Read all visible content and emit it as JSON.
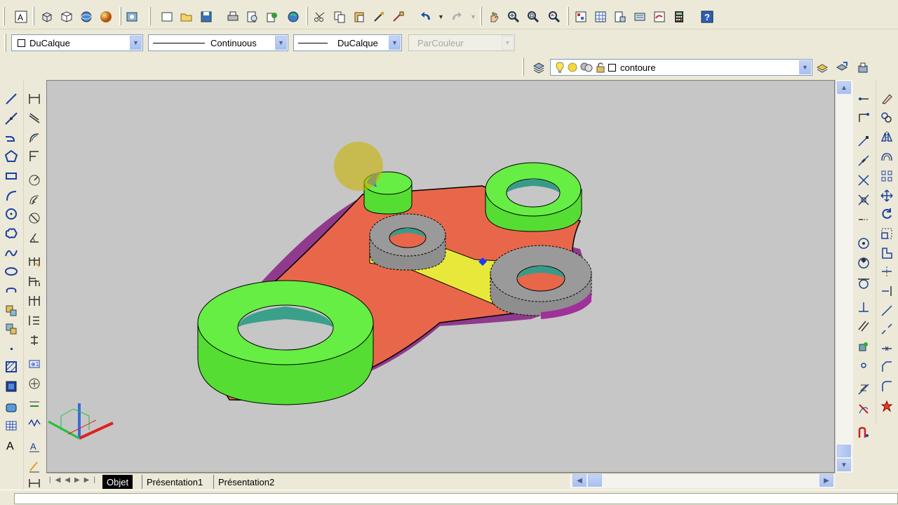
{
  "toolbar_top": {
    "icons": [
      "new-text-icon",
      "box-icon",
      "wedge-icon",
      "sphere-icon",
      "shade-sphere-icon",
      "render-icon",
      "new-file-icon",
      "open-file-icon",
      "save-icon",
      "print-icon",
      "plot-preview-icon",
      "publish-icon",
      "web-icon",
      "cut-icon",
      "copy-icon",
      "paste-icon",
      "match-properties-icon",
      "block-editor-icon",
      "undo-icon",
      "redo-icon",
      "pan-icon",
      "zoom-realtime-icon",
      "zoom-window-icon",
      "zoom-previous-icon",
      "properties-icon",
      "design-center-icon",
      "tool-palettes-icon",
      "sheet-set-icon",
      "markup-icon",
      "quickcalc-icon",
      "help-icon"
    ]
  },
  "properties_bar": {
    "color_value": "DuCalque",
    "linetype_value": "Continuous",
    "lineweight_value": "DuCalque",
    "plotstyle_value": "ParCouleur"
  },
  "layers_bar": {
    "layer_name": "contoure",
    "icons": [
      "layer-manager-icon",
      "bulb-icon",
      "sun-icon",
      "lock-icon",
      "color-swatch-icon",
      "make-current-icon",
      "layer-previous-icon",
      "layer-states-icon"
    ]
  },
  "left_toolbar_draw": [
    "line-icon",
    "construction-line-icon",
    "polyline-icon",
    "polygon-icon",
    "rectangle-icon",
    "arc-icon",
    "circle-icon",
    "revision-cloud-icon",
    "spline-icon",
    "ellipse-icon",
    "ellipse-arc-icon",
    "insert-block-icon",
    "make-block-icon",
    "point-icon",
    "hatch-icon",
    "gradient-icon",
    "region-icon",
    "table-icon",
    "mtext-icon"
  ],
  "left_toolbar_dimension": [
    "linear-dim-icon",
    "aligned-dim-icon",
    "arc-length-icon",
    "ordinate-dim-icon",
    "radius-dim-icon",
    "jogged-dim-icon",
    "diameter-dim-icon",
    "angular-dim-icon",
    "quick-dim-icon",
    "baseline-dim-icon",
    "continue-dim-icon",
    "quick-leader-icon",
    "tolerance-icon",
    "center-mark-icon",
    "dim-edit-icon",
    "dim-text-edit-icon",
    "dim-update-icon",
    "dim-style-icon"
  ],
  "right_toolbar_snap": [
    "temp-track-icon",
    "snap-from-icon",
    "snap-endpoint-icon",
    "snap-midpoint-icon",
    "snap-intersection-icon",
    "snap-apparent-icon",
    "snap-extension-icon",
    "snap-center-icon",
    "snap-quadrant-icon",
    "snap-tangent-icon",
    "snap-perpendicular-icon",
    "snap-parallel-icon",
    "snap-insert-icon",
    "snap-node-icon",
    "snap-nearest-icon",
    "snap-none-icon",
    "osnap-settings-icon"
  ],
  "right_toolbar_modify": [
    "erase-icon",
    "copy-object-icon",
    "mirror-icon",
    "offset-icon",
    "array-icon",
    "move-icon",
    "rotate-icon",
    "scale-icon",
    "stretch-icon",
    "trim-icon",
    "extend-icon",
    "break-at-point-icon",
    "break-icon",
    "join-icon",
    "chamfer-icon",
    "fillet-icon",
    "explode-icon"
  ],
  "tabs": {
    "model": "Objet",
    "layout1": "Présentation1",
    "layout2": "Présentation2"
  },
  "colors": {
    "plate": "#e8674a",
    "ring_green": "#66ee44",
    "ring_yellow": "#e8e83a",
    "selected_gray": "#909090",
    "purple_side": "#a0309a",
    "viewport_bg": "#c6c6c6"
  }
}
